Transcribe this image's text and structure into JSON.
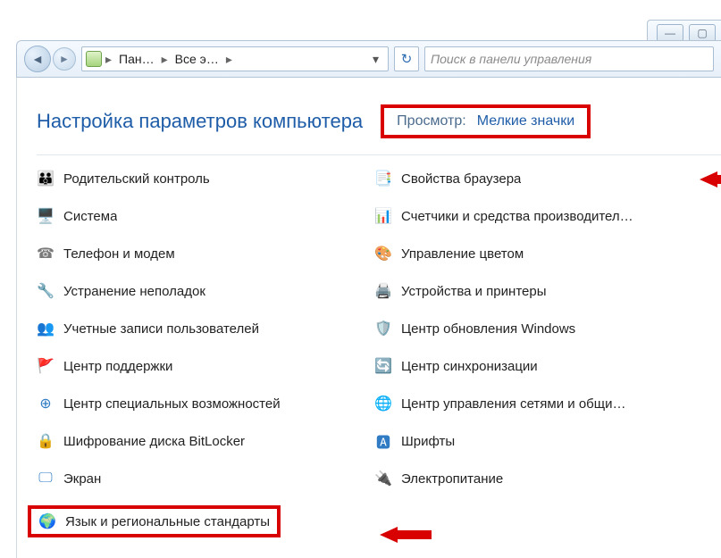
{
  "breadcrumb": {
    "part1": "Пан…",
    "part2": "Все э…"
  },
  "search": {
    "placeholder": "Поиск в панели управления"
  },
  "page_title": "Настройка параметров компьютера",
  "view": {
    "label": "Просмотр:",
    "value": "Мелкие значки"
  },
  "items_left": [
    "Родительский контроль",
    "Система",
    "Телефон и модем",
    "Устранение неполадок",
    "Учетные записи пользователей",
    "Центр поддержки",
    "Центр специальных возможностей",
    "Шифрование диска BitLocker",
    "Экран",
    "Язык и региональные стандарты"
  ],
  "items_right": [
    "Свойства браузера",
    "Счетчики и средства производител…",
    "Управление цветом",
    "Устройства и принтеры",
    "Центр обновления Windows",
    "Центр синхронизации",
    "Центр управления сетями и общи…",
    "Шрифты",
    "Электропитание"
  ]
}
